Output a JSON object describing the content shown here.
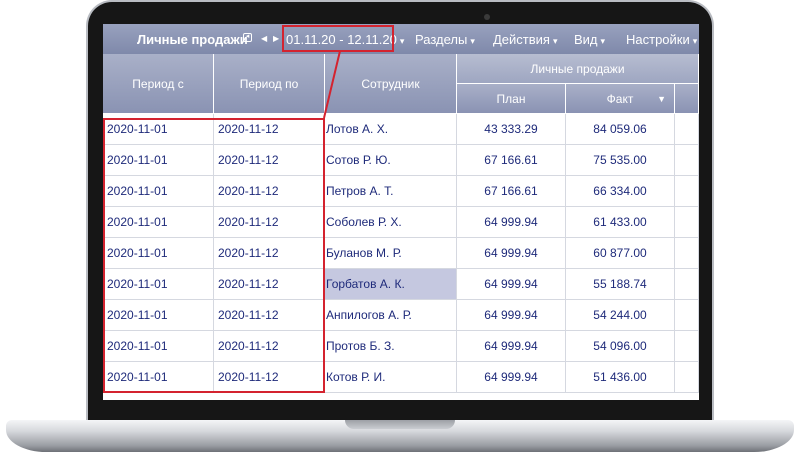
{
  "toolbar": {
    "title": "Личные продажи",
    "period_button": "01.11.20 - 12.11.20",
    "menus": [
      {
        "label": "Разделы"
      },
      {
        "label": "Действия"
      },
      {
        "label": "Вид"
      },
      {
        "label": "Настройки"
      }
    ]
  },
  "grid": {
    "headers": {
      "period_from": "Период с",
      "period_to": "Период по",
      "employee": "Сотрудник",
      "group": "Личные продажи",
      "plan": "План",
      "fact": "Факт"
    },
    "rows": [
      {
        "from": "2020-11-01",
        "to": "2020-11-12",
        "employee": "Лотов А. Х.",
        "plan": "43 333.29",
        "fact": "84 059.06"
      },
      {
        "from": "2020-11-01",
        "to": "2020-11-12",
        "employee": "Сотов Р. Ю.",
        "plan": "67 166.61",
        "fact": "75 535.00"
      },
      {
        "from": "2020-11-01",
        "to": "2020-11-12",
        "employee": "Петров А. Т.",
        "plan": "67 166.61",
        "fact": "66 334.00"
      },
      {
        "from": "2020-11-01",
        "to": "2020-11-12",
        "employee": "Соболев Р. Х.",
        "plan": "64 999.94",
        "fact": "61 433.00"
      },
      {
        "from": "2020-11-01",
        "to": "2020-11-12",
        "employee": "Буланов М. Р.",
        "plan": "64 999.94",
        "fact": "60 877.00"
      },
      {
        "from": "2020-11-01",
        "to": "2020-11-12",
        "employee": "Горбатов А. К.",
        "plan": "64 999.94",
        "fact": "55 188.74"
      },
      {
        "from": "2020-11-01",
        "to": "2020-11-12",
        "employee": "Анпилогов А. Р.",
        "plan": "64 999.94",
        "fact": "54 244.00"
      },
      {
        "from": "2020-11-01",
        "to": "2020-11-12",
        "employee": "Протов Б. З.",
        "plan": "64 999.94",
        "fact": "54 096.00"
      },
      {
        "from": "2020-11-01",
        "to": "2020-11-12",
        "employee": "Котов Р. И.",
        "plan": "64 999.94",
        "fact": "51 436.00"
      }
    ],
    "selected_row_index": 5
  },
  "colors": {
    "highlight": "#d4232f",
    "header": "#8a93b3",
    "text": "#1e2a7a",
    "selection": "#c5c8e0"
  }
}
